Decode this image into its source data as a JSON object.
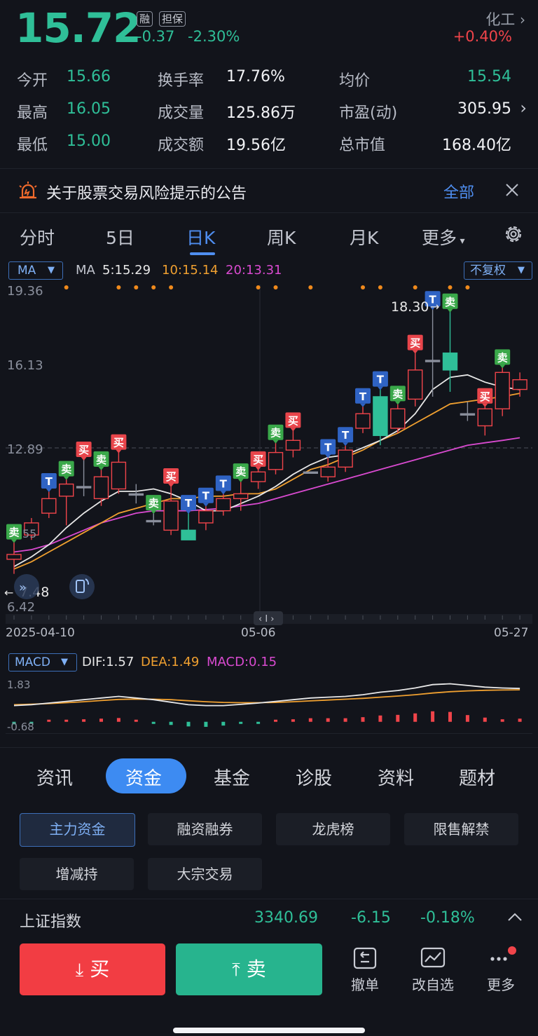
{
  "header": {
    "price": "15.72",
    "tags": [
      "融",
      "担保"
    ],
    "change": "-0.37",
    "change_pct": "-2.30%",
    "industry": "化工",
    "industry_change": "+0.40%"
  },
  "stats": [
    {
      "label": "今开",
      "value": "15.66"
    },
    {
      "label": "换手率",
      "value": "17.76%"
    },
    {
      "label": "均价",
      "value": "15.54"
    },
    {
      "label": "最高",
      "value": "16.05"
    },
    {
      "label": "成交量",
      "value": "125.86万"
    },
    {
      "label": "市盈(动)",
      "value": "305.95"
    },
    {
      "label": "最低",
      "value": "15.00"
    },
    {
      "label": "成交额",
      "value": "19.56亿"
    },
    {
      "label": "总市值",
      "value": "168.40亿"
    }
  ],
  "notice": {
    "text": "关于股票交易风险提示的公告",
    "all_label": "全部"
  },
  "chart_tabs": [
    "分时",
    "5日",
    "日K",
    "周K",
    "月K",
    "更多"
  ],
  "ma_bar": {
    "selector": "MA",
    "label": "MA",
    "ma5": "5:15.29",
    "ma10": "10:15.14",
    "ma20": "20:13.31",
    "adjust": "不复权"
  },
  "price_axis": [
    "19.36",
    "16.13",
    "12.89",
    "6.42"
  ],
  "hi_label": "18.30",
  "lo_label": "7.48",
  "partial_label": "55",
  "dates": [
    "2025-04-10",
    "05-06",
    "05-27"
  ],
  "macd_bar": {
    "selector": "MACD",
    "dif": "DIF:1.57",
    "dea": "DEA:1.49",
    "macd": "MACD:0.15",
    "axis_top": "1.83",
    "axis_bottom": "-0.68"
  },
  "chart_data": {
    "type": "candlestick",
    "ylim": [
      6.42,
      19.36
    ],
    "candles": [
      {
        "o": 8.3,
        "h": 9.0,
        "l": 7.7,
        "c": 8.5
      },
      {
        "o": 9.3,
        "h": 10.0,
        "l": 9.1,
        "c": 9.8
      },
      {
        "o": 10.2,
        "h": 11.1,
        "l": 10.0,
        "c": 10.8
      },
      {
        "o": 10.9,
        "h": 11.6,
        "l": 9.7,
        "c": 11.4
      },
      {
        "o": 11.3,
        "h": 12.4,
        "l": 10.9,
        "c": 11.3
      },
      {
        "o": 10.8,
        "h": 12.0,
        "l": 10.5,
        "c": 11.7
      },
      {
        "o": 11.2,
        "h": 12.7,
        "l": 11.0,
        "c": 12.3
      },
      {
        "o": 11.0,
        "h": 11.4,
        "l": 10.6,
        "c": 11.0
      },
      {
        "o": 9.9,
        "h": 10.2,
        "l": 9.7,
        "c": 9.9
      },
      {
        "o": 9.5,
        "h": 11.3,
        "l": 9.3,
        "c": 10.7
      },
      {
        "o": 9.5,
        "h": 10.2,
        "l": 9.3,
        "c": 9.1
      },
      {
        "o": 9.8,
        "h": 10.5,
        "l": 9.5,
        "c": 10.3
      },
      {
        "o": 10.3,
        "h": 11.0,
        "l": 10.1,
        "c": 10.8
      },
      {
        "o": 10.8,
        "h": 11.5,
        "l": 10.3,
        "c": 11.0
      },
      {
        "o": 11.5,
        "h": 12.0,
        "l": 11.2,
        "c": 11.9
      },
      {
        "o": 12.0,
        "h": 13.1,
        "l": 11.8,
        "c": 12.7
      },
      {
        "o": 12.8,
        "h": 13.6,
        "l": 12.5,
        "c": 13.2
      },
      {
        "o": 11.9,
        "h": 11.9,
        "l": 11.9,
        "c": 11.9
      },
      {
        "o": 11.7,
        "h": 12.5,
        "l": 11.5,
        "c": 12.1
      },
      {
        "o": 12.1,
        "h": 13.0,
        "l": 11.9,
        "c": 12.8
      },
      {
        "o": 13.7,
        "h": 14.6,
        "l": 13.5,
        "c": 14.3
      },
      {
        "o": 15.0,
        "h": 15.3,
        "l": 13.0,
        "c": 13.4
      },
      {
        "o": 13.7,
        "h": 14.7,
        "l": 13.5,
        "c": 14.5
      },
      {
        "o": 14.9,
        "h": 16.8,
        "l": 14.6,
        "c": 16.1
      },
      {
        "o": 16.5,
        "h": 18.6,
        "l": 15.0,
        "c": 16.5
      },
      {
        "o": 16.8,
        "h": 18.5,
        "l": 15.2,
        "c": 16.1
      },
      {
        "o": 14.3,
        "h": 14.8,
        "l": 14.0,
        "c": 14.3
      },
      {
        "o": 13.8,
        "h": 14.6,
        "l": 13.4,
        "c": 14.5
      },
      {
        "o": 14.5,
        "h": 16.2,
        "l": 14.2,
        "c": 16.0
      },
      {
        "o": 15.3,
        "h": 16.0,
        "l": 15.0,
        "c": 15.7
      }
    ],
    "ma5": [
      8.0,
      8.4,
      8.9,
      9.6,
      10.2,
      10.7,
      11.1,
      11.1,
      11.2,
      11.0,
      10.7,
      10.3,
      10.3,
      10.6,
      10.9,
      11.3,
      11.8,
      12.2,
      12.5,
      12.6,
      12.9,
      13.2,
      13.6,
      14.3,
      15.3,
      15.8,
      15.9,
      15.6,
      15.4,
      15.29
    ],
    "ma10": [
      7.9,
      8.2,
      8.6,
      9.0,
      9.4,
      9.8,
      10.2,
      10.4,
      10.6,
      10.8,
      10.8,
      10.9,
      10.9,
      11.0,
      11.0,
      11.2,
      11.6,
      12.0,
      12.2,
      12.5,
      12.8,
      13.2,
      13.5,
      13.9,
      14.3,
      14.7,
      14.8,
      14.9,
      15.0,
      15.14
    ],
    "ma20": [
      8.6,
      8.7,
      8.9,
      9.2,
      9.5,
      9.8,
      10.0,
      10.2,
      10.3,
      10.3,
      10.3,
      10.35,
      10.4,
      10.5,
      10.6,
      10.8,
      11.0,
      11.2,
      11.4,
      11.6,
      11.8,
      12.0,
      12.2,
      12.4,
      12.6,
      12.8,
      13.0,
      13.1,
      13.2,
      13.31
    ],
    "macd_dif": [
      0.55,
      0.6,
      0.7,
      0.8,
      0.9,
      1.0,
      1.1,
      1.0,
      0.9,
      0.75,
      0.6,
      0.55,
      0.55,
      0.62,
      0.7,
      0.8,
      0.9,
      1.0,
      1.05,
      1.1,
      1.2,
      1.35,
      1.45,
      1.6,
      1.8,
      1.85,
      1.75,
      1.65,
      1.6,
      1.57
    ],
    "macd_dea": [
      0.6,
      0.63,
      0.67,
      0.72,
      0.78,
      0.85,
      0.92,
      0.94,
      0.93,
      0.9,
      0.84,
      0.78,
      0.74,
      0.72,
      0.72,
      0.74,
      0.78,
      0.83,
      0.88,
      0.93,
      0.98,
      1.05,
      1.12,
      1.2,
      1.3,
      1.38,
      1.43,
      1.46,
      1.48,
      1.49
    ],
    "macd_hist": [
      -0.12,
      -0.08,
      0.02,
      0.08,
      0.12,
      0.15,
      0.18,
      0.1,
      -0.05,
      -0.15,
      -0.22,
      -0.24,
      -0.18,
      -0.1,
      -0.02,
      0.06,
      0.12,
      0.17,
      0.17,
      0.17,
      0.22,
      0.3,
      0.33,
      0.4,
      0.5,
      0.47,
      0.32,
      0.2,
      0.12,
      0.15
    ],
    "signals": [
      {
        "i": 0,
        "t": "卖"
      },
      {
        "i": 2,
        "t": "T"
      },
      {
        "i": 3,
        "t": "卖"
      },
      {
        "i": 4,
        "t": "买"
      },
      {
        "i": 5,
        "t": "卖"
      },
      {
        "i": 6,
        "t": "买"
      },
      {
        "i": 8,
        "t": "卖"
      },
      {
        "i": 9,
        "t": "买"
      },
      {
        "i": 10,
        "t": "T"
      },
      {
        "i": 11,
        "t": "T"
      },
      {
        "i": 12,
        "t": "T"
      },
      {
        "i": 13,
        "t": "卖"
      },
      {
        "i": 14,
        "t": "买"
      },
      {
        "i": 15,
        "t": "卖"
      },
      {
        "i": 16,
        "t": "买"
      },
      {
        "i": 18,
        "t": "T"
      },
      {
        "i": 19,
        "t": "T"
      },
      {
        "i": 20,
        "t": "T"
      },
      {
        "i": 21,
        "t": "T"
      },
      {
        "i": 22,
        "t": "卖"
      },
      {
        "i": 23,
        "t": "买"
      },
      {
        "i": 24,
        "t": "T"
      },
      {
        "i": 25,
        "t": "卖"
      },
      {
        "i": 27,
        "t": "买"
      },
      {
        "i": 28,
        "t": "卖"
      }
    ],
    "dots": [
      3,
      6,
      7,
      8,
      9,
      14,
      15,
      17,
      20,
      21,
      23,
      25,
      26
    ]
  },
  "bottom_tabs": [
    "资讯",
    "资金",
    "基金",
    "诊股",
    "资料",
    "题材"
  ],
  "sub_tabs": [
    "主力资金",
    "融资融券",
    "龙虎榜",
    "限售解禁",
    "增减持",
    "大宗交易"
  ],
  "index_bar": {
    "name": "上证指数",
    "value": "3340.69",
    "change": "-6.15",
    "change_pct": "-0.18%"
  },
  "actions": {
    "buy": "买",
    "sell": "卖",
    "cancel": "撤单",
    "watchlist": "改自选",
    "more": "更多"
  },
  "colors": {
    "up": "#f0444a",
    "down": "#2fbf98",
    "ma5": "#e8e8e8",
    "ma10": "#f0a030",
    "ma20": "#d94ad0",
    "accent": "#4f8ef0"
  }
}
